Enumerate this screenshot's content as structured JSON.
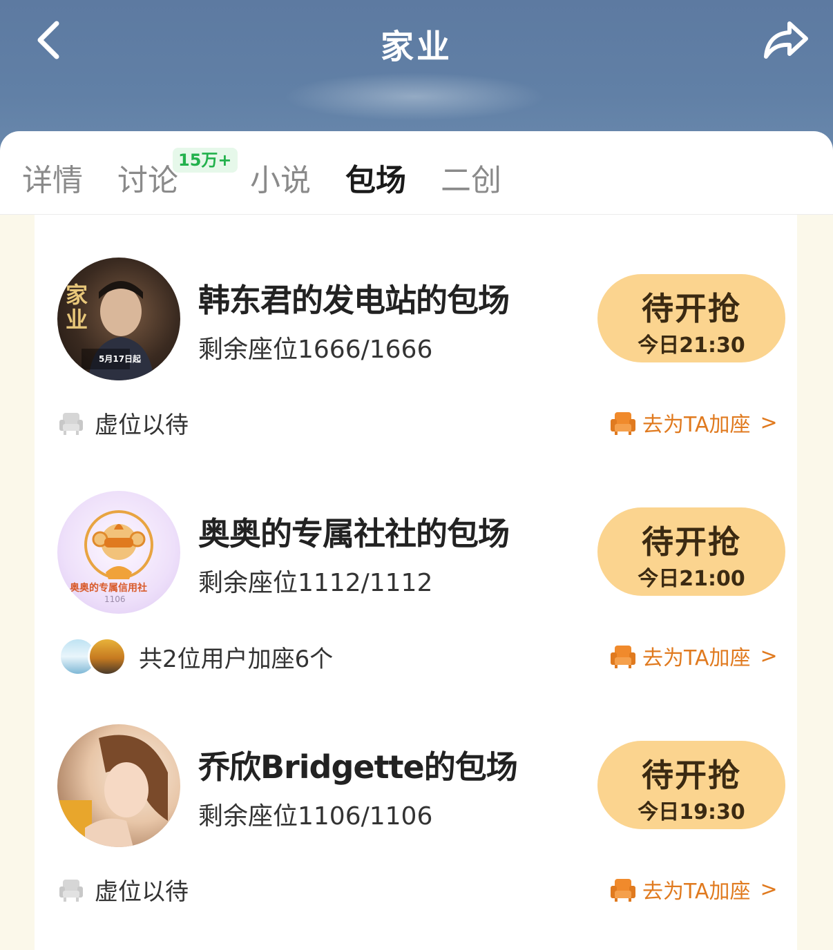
{
  "header": {
    "title": "家业",
    "back_icon": "chevron-left-icon",
    "share_icon": "share-arrow-icon"
  },
  "tabs": [
    {
      "label": "详情",
      "active": false
    },
    {
      "label": "讨论",
      "active": false,
      "badge": "15万+"
    },
    {
      "label": "小说",
      "active": false
    },
    {
      "label": "包场",
      "active": true
    },
    {
      "label": "二创",
      "active": false
    }
  ],
  "colors": {
    "header_bg": "#5d7aa1",
    "button_bg": "#fbd48f",
    "accent_orange": "#e07a1f",
    "badge_green": "#22b14c"
  },
  "cards": [
    {
      "title": "韩东君的发电站的包场",
      "seats": "剩余座位1666/1666",
      "button_label": "待开抢",
      "button_time": "今日21:30",
      "footer_text": "虚位以待",
      "action": "去为TA加座",
      "chevron": ">",
      "avatar_text": "家业",
      "avatar_sub": "5月17日起"
    },
    {
      "title": "奥奥的专属社社的包场",
      "seats": "剩余座位1112/1112",
      "button_label": "待开抢",
      "button_time": "今日21:00",
      "footer_text": "共2位用户加座6个",
      "action": "去为TA加座",
      "chevron": ">",
      "avatar_text": "奥奥的专属信用社",
      "avatar_sub": "1106"
    },
    {
      "title": "乔欣Bridgette的包场",
      "seats": "剩余座位1106/1106",
      "button_label": "待开抢",
      "button_time": "今日19:30",
      "footer_text": "虚位以待",
      "action": "去为TA加座",
      "chevron": ">"
    }
  ]
}
